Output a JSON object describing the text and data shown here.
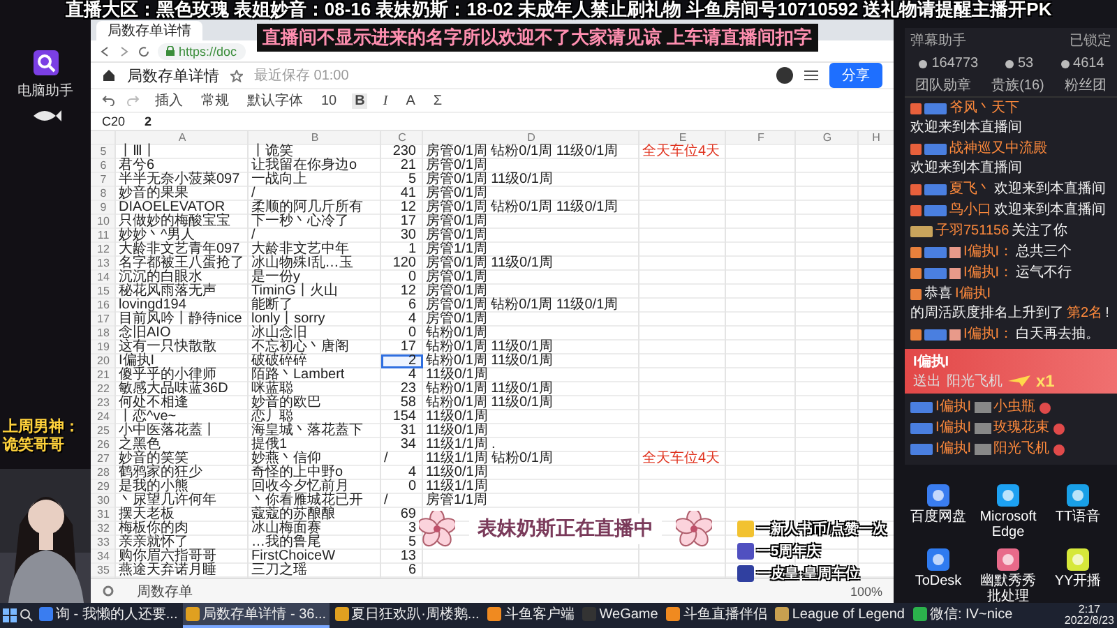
{
  "top_banner": "直播大区：黑色玫瑰 表姐妙音：08-16 表妹奶斯：18-02 未成年人禁止刷礼物 斗鱼房间号10710592 送礼物请提醒主播开PK",
  "notice": "直播间不显示进来的名字所以欢迎不了大家请见谅 上车请直播间扣字",
  "left_strip": {
    "app_label": "电脑助手",
    "last_week": "上周男神：诡笑哥哥"
  },
  "browser": {
    "tab_title": "局数存单详情",
    "url": "https://doc"
  },
  "doc": {
    "title": "局数存单详情",
    "saved": "最近保存 01:00",
    "share": "分享"
  },
  "toolbar": {
    "insert": "插入",
    "format": "常规",
    "font": "默认字体",
    "size": "10",
    "bold": "B",
    "italic": "I",
    "text_color": "A",
    "sum": "Σ"
  },
  "formula_bar": {
    "cell": "C20",
    "value": "2"
  },
  "sheet": {
    "columns": [
      "A",
      "B",
      "C",
      "D",
      "E",
      "F",
      "G",
      "H"
    ],
    "rows": [
      {
        "num": "5",
        "a": "丨Ⅲ丨",
        "b": "丨诡笑",
        "c": "230",
        "kind": "number",
        "d": "房管0/1周 钻粉0/1周 11级0/1周",
        "e": "全天车位4天",
        "selected": false
      },
      {
        "num": "6",
        "a": "君兮6",
        "b": "让我留在你身边o",
        "c": "21",
        "kind": "number",
        "d": "房管0/1周",
        "selected": false
      },
      {
        "num": "7",
        "a": "半半无奈小菠菜097",
        "b": "一战向上",
        "c": "5",
        "kind": "number",
        "d": "房管0/1周 11级0/1周",
        "selected": false
      },
      {
        "num": "8",
        "a": "妙音的果果",
        "b": "/",
        "c": "41",
        "kind": "number",
        "d": "房管0/1周",
        "selected": false
      },
      {
        "num": "9",
        "a": "DIAOELEVATOR",
        "b": "柔顺的阿几斤所有",
        "c": "12",
        "kind": "number",
        "d": "房管0/1周 钻粉0/1周 11级0/1周",
        "selected": false
      },
      {
        "num": "10",
        "a": "只做妙的梅酸宝宝",
        "b": "下一秒丶心冷了",
        "c": "17",
        "kind": "number",
        "d": "房管0/1周",
        "selected": false
      },
      {
        "num": "11",
        "a": "妙妙丶^男人",
        "b": "/",
        "c": "30",
        "kind": "number",
        "d": "房管0/1周",
        "selected": false
      },
      {
        "num": "12",
        "a": "大龄非文艺青年097",
        "b": "大龄非文艺中年",
        "c": "1",
        "kind": "number",
        "d": "房管1/1周",
        "selected": false
      },
      {
        "num": "13",
        "a": "名字都被王八蛋抢了",
        "b": "冰山物殊I乱…玉",
        "c": "120",
        "kind": "number",
        "d": "房管0/1周 11级0/1周",
        "selected": false
      },
      {
        "num": "14",
        "a": "沉沉的白眼水",
        "b": "是一份y",
        "c": "0",
        "kind": "number",
        "d": "房管0/1周",
        "selected": false
      },
      {
        "num": "15",
        "a": "秘花风雨落无声",
        "b": "TiminG丨火山",
        "c": "12",
        "kind": "number",
        "d": "房管0/1周",
        "selected": false
      },
      {
        "num": "16",
        "a": "lovingd194",
        "b": "能断了",
        "c": "6",
        "kind": "number",
        "d": "房管0/1周 钻粉0/1周 11级0/1周",
        "selected": false
      },
      {
        "num": "17",
        "a": "目前风吟丨静待nice",
        "b": "lonly丨sorry",
        "c": "4",
        "kind": "number",
        "d": "房管0/1周",
        "selected": false
      },
      {
        "num": "18",
        "a": "念旧AIO",
        "b": "冰山念旧",
        "c": "0",
        "kind": "number",
        "d": "钻粉0/1周",
        "selected": false
      },
      {
        "num": "19",
        "a": "这有一只快散散",
        "b": "不忘初心丶唐阁",
        "c": "17",
        "kind": "number",
        "d": "钻粉0/1周 11级0/1周",
        "selected": false
      },
      {
        "num": "20",
        "a": "I偏执I",
        "b": "破破碎碎",
        "c": "2",
        "kind": "number",
        "d": "钻粉0/1周 11级0/1周",
        "selected": true
      },
      {
        "num": "21",
        "a": "傻乎乎的小律师",
        "b": "陌路丶Lambert",
        "c": "4",
        "kind": "number",
        "d": "11级0/1周",
        "selected": false
      },
      {
        "num": "22",
        "a": "敏感大品味蓝36D",
        "b": "咪蓝聪",
        "c": "23",
        "kind": "number",
        "d": "钻粉0/1周 11级0/1周",
        "selected": false
      },
      {
        "num": "23",
        "a": "何处不相逢",
        "b": "妙音的欧巴",
        "c": "58",
        "kind": "number",
        "d": "钻粉0/1周 11级0/1周",
        "selected": false
      },
      {
        "num": "24",
        "a": "丨恋^ve~",
        "b": "恋丿聪",
        "c": "154",
        "kind": "number",
        "d": "11级0/1周",
        "selected": false
      },
      {
        "num": "25",
        "a": "小中医落花蓋丨",
        "b": "海皇城丶落花蓋下",
        "c": "31",
        "kind": "number",
        "d": "11级0/1周",
        "selected": false
      },
      {
        "num": "26",
        "a": "之黑色",
        "b": "提俄1",
        "c": "34",
        "kind": "number",
        "d": "11级1/1周 .",
        "selected": false
      },
      {
        "num": "27",
        "a": "妙音的笑笑",
        "b": "妙燕丶信仰",
        "c": "/",
        "kind": "text",
        "d": "11级1/1周 钻粉0/1周",
        "e": "全天车位4天",
        "selected": false
      },
      {
        "num": "28",
        "a": "鹤鸦家的狂少",
        "b": "奇怪的上中野o",
        "c": "4",
        "kind": "number",
        "d": "11级0/1周",
        "selected": false
      },
      {
        "num": "29",
        "a": "是我的小熊",
        "b": "回收今夕忆前月",
        "c": "0",
        "kind": "number",
        "d": "11级1/1周",
        "selected": false
      },
      {
        "num": "30",
        "a": "丶尿望几许何年",
        "b": "丶你看雁城花已开",
        "c": "/",
        "kind": "text",
        "d": "房管1/1周",
        "selected": false
      },
      {
        "num": "31",
        "a": "摆天老板",
        "b": "蔻蔻的苏酿酿",
        "c": "69",
        "kind": "number",
        "selected": false
      },
      {
        "num": "32",
        "a": "梅板你的肉",
        "b": "冰山梅面赛",
        "c": "3",
        "kind": "number",
        "selected": false
      },
      {
        "num": "33",
        "a": "亲亲就怀了",
        "b": "…我的鲁尾",
        "c": "5",
        "kind": "number",
        "selected": false
      },
      {
        "num": "34",
        "a": "购你眉六指哥哥",
        "b": "FirstChoiceW",
        "c": "13",
        "kind": "number",
        "selected": false
      },
      {
        "num": "35",
        "a": "燕途天弃诺月睡",
        "b": "三刀之瑶",
        "c": "6",
        "kind": "number",
        "selected": false
      }
    ],
    "sheet_tab": "周数存单",
    "zoom": "100%"
  },
  "chat_panel": {
    "title": "弹幕助手",
    "lock": "已锁定",
    "stats": [
      "164773",
      "53",
      "4614"
    ],
    "tabs": [
      "团队勋章",
      "贵族(16)",
      "粉丝团"
    ],
    "messages": [
      {
        "kind": "welcome",
        "name": "爷风丶天下",
        "text": "欢迎来到本直播间"
      },
      {
        "kind": "welcome",
        "name": "战神巡又中流殿",
        "text": "欢迎来到本直播间"
      },
      {
        "kind": "welcome",
        "name": "夏飞丶",
        "text": "欢迎来到本直播间"
      },
      {
        "kind": "welcome",
        "name": "鸟小口",
        "text": "欢迎来到本直播间"
      },
      {
        "kind": "follow",
        "name": "子羽751156",
        "text": "关注了你"
      },
      {
        "kind": "chat",
        "name": "I偏执I：",
        "text": "总共三个"
      },
      {
        "kind": "chat",
        "name": "I偏执I：",
        "text": "运气不行"
      },
      {
        "kind": "system",
        "prefix": "恭喜",
        "name": "I偏执I",
        "text": "的周活跃度排名上升到了",
        "rank": "第2名",
        "suffix": "!"
      },
      {
        "kind": "chat",
        "name": "I偏执I：",
        "text": "白天再去抽。"
      },
      {
        "kind": "banner",
        "name": "I偏执I",
        "action": "送出",
        "gift": "阳光飞机",
        "count": "x1"
      },
      {
        "kind": "gift",
        "name": "I偏执I",
        "gift": "小虫瓶"
      },
      {
        "kind": "gift",
        "name": "I偏执I",
        "gift": "玫瑰花束"
      },
      {
        "kind": "gift",
        "name": "I偏执I",
        "gift": "阳光飞机"
      }
    ]
  },
  "desktop_icons": [
    "百度网盘",
    "Microsoft Edge",
    "TT语音",
    "ToDesk",
    "幽默秀秀批处理",
    "YY开播"
  ],
  "live_caption": "表妹奶斯正在直播中",
  "gift_list": [
    "一新人书币/点赞一次",
    "一5周年庆",
    "一皮皇·皇周车位"
  ],
  "taskbar": {
    "items": [
      {
        "label": "询 - 我懒的人还要...",
        "active": false
      },
      {
        "label": "局数存单详情 - 36...",
        "active": true
      },
      {
        "label": "夏日狂欢趴·周楼鹅...",
        "active": false
      },
      {
        "label": "斗鱼客户端",
        "active": false
      },
      {
        "label": "WeGame",
        "active": false
      },
      {
        "label": "斗鱼直播伴侣",
        "active": false
      },
      {
        "label": "League of Legend",
        "active": false
      },
      {
        "label": "微信: IV~nice",
        "active": false
      }
    ],
    "time": "2:17",
    "date": "2022/8/23"
  }
}
